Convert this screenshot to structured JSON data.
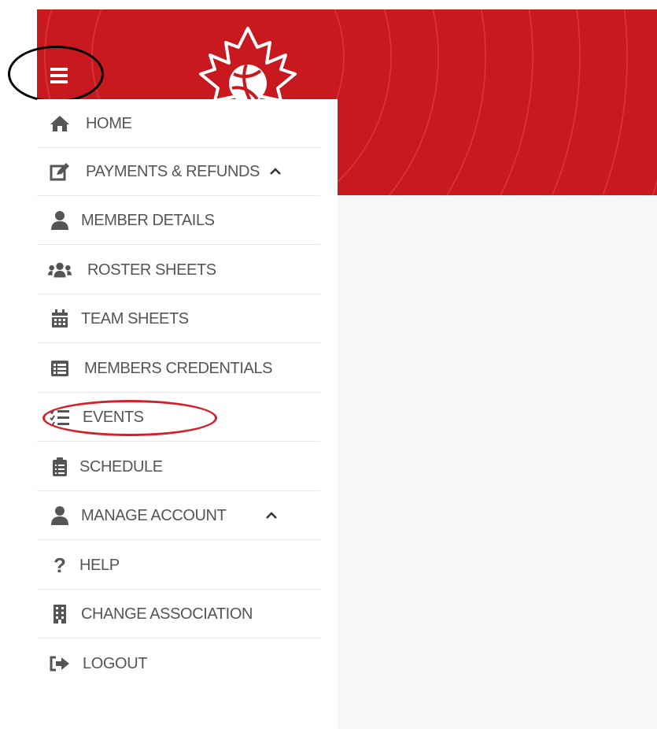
{
  "colors": {
    "banner": "#c8191f",
    "content_bg": "#f6f7f9",
    "menu_text": "#555555",
    "annotation_black": "#000000",
    "annotation_red": "#d4202a"
  },
  "menu": {
    "items": [
      {
        "label": "HOME",
        "icon": "home-icon"
      },
      {
        "label": "PAYMENTS & REFUNDS",
        "icon": "edit-icon",
        "chevron": "chevron-up-icon"
      },
      {
        "label": "MEMBER DETAILS",
        "icon": "user-icon"
      },
      {
        "label": "ROSTER SHEETS",
        "icon": "users-icon"
      },
      {
        "label": "TEAM SHEETS",
        "icon": "calendar-icon"
      },
      {
        "label": "MEMBERS CREDENTIALS",
        "icon": "list-icon"
      },
      {
        "label": "EVENTS",
        "icon": "tasks-icon"
      },
      {
        "label": "SCHEDULE",
        "icon": "clipboard-icon"
      },
      {
        "label": "MANAGE ACCOUNT",
        "icon": "user-icon",
        "chevron": "chevron-up-icon"
      },
      {
        "label": "HELP",
        "icon": "question-icon"
      },
      {
        "label": "CHANGE ASSOCIATION",
        "icon": "building-icon"
      },
      {
        "label": "LOGOUT",
        "icon": "sign-out-icon"
      }
    ]
  }
}
